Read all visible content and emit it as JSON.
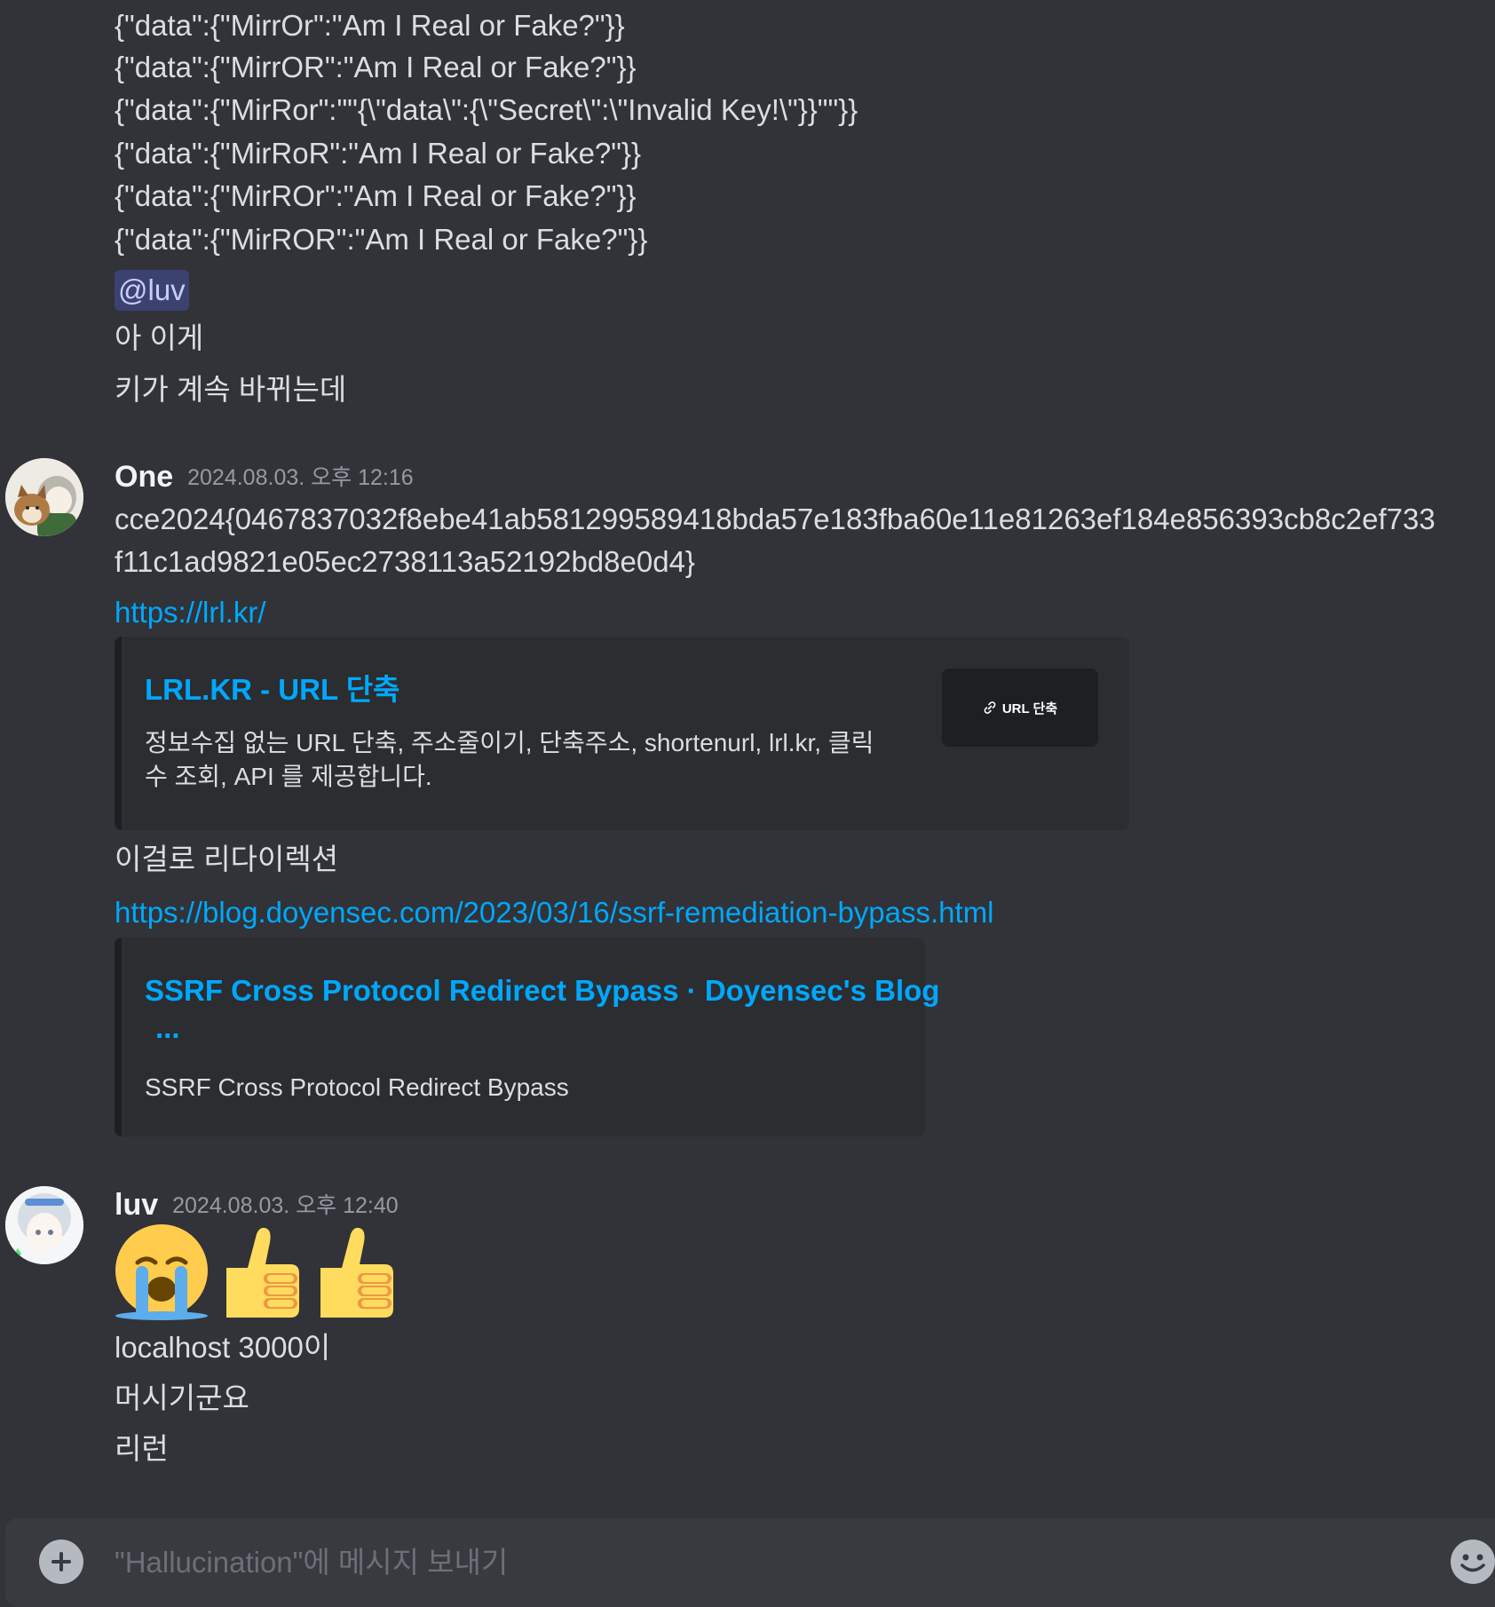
{
  "messages_top": {
    "lines": [
      "{\"data\":{\"MirrOr\":\"Am I Real or Fake?\"}}",
      "{\"data\":{\"MirrOR\":\"Am I Real or Fake?\"}}",
      "{\"data\":{\"MirRor\":\"\"{\\\"data\\\":{\\\"Secret\\\":\\\"Invalid Key!\\\"}}\"\"}}",
      "{\"data\":{\"MirRoR\":\"Am I Real or Fake?\"}}",
      "{\"data\":{\"MirROr\":\"Am I Real or Fake?\"}}",
      "{\"data\":{\"MirROR\":\"Am I Real or Fake?\"}}"
    ],
    "mention": "@luv",
    "korean_1": "아 이게",
    "korean_2": "키가 계속 바뀌는데"
  },
  "message_one": {
    "author": "One",
    "timestamp": "2024.08.03. 오후 12:16",
    "flag_line_1": "cce2024{0467837032f8ebe41ab581299589418bda57e183fba60e11e81263ef184e856393cb8c2ef733",
    "flag_line_2": "f11c1ad9821e05ec2738113a52192bd8e0d4}",
    "link_1": "https://lrl.kr/",
    "embed_1": {
      "title": "LRL.KR - URL 단축",
      "desc_line_1": "정보수집 없는 URL 단축, 주소줄이기, 단축주소, shortenurl, lrl.kr, 클릭",
      "desc_line_2": "수 조회, API 를 제공합니다.",
      "thumb_label": "URL 단축"
    },
    "text_redirect": "이걸로 리다이렉션",
    "link_2": "https://blog.doyensec.com/2023/03/16/ssrf-remediation-bypass.html",
    "embed_2": {
      "title": "SSRF Cross Protocol Redirect Bypass · Doyensec's Blog",
      "ellipsis": "...",
      "desc": "SSRF Cross Protocol Redirect Bypass"
    }
  },
  "message_luv": {
    "author": "luv",
    "timestamp": "2024.08.03. 오후 12:40",
    "line_1": "localhost 3000이",
    "line_2": "머시기군요",
    "line_3": "리런"
  },
  "composer": {
    "placeholder": "\"Hallucination\"에 메시지 보내기"
  },
  "colors": {
    "background": "#313338",
    "link": "#00a8fc",
    "mention_bg": "#3c4270",
    "embed_bg": "#2b2d31"
  }
}
